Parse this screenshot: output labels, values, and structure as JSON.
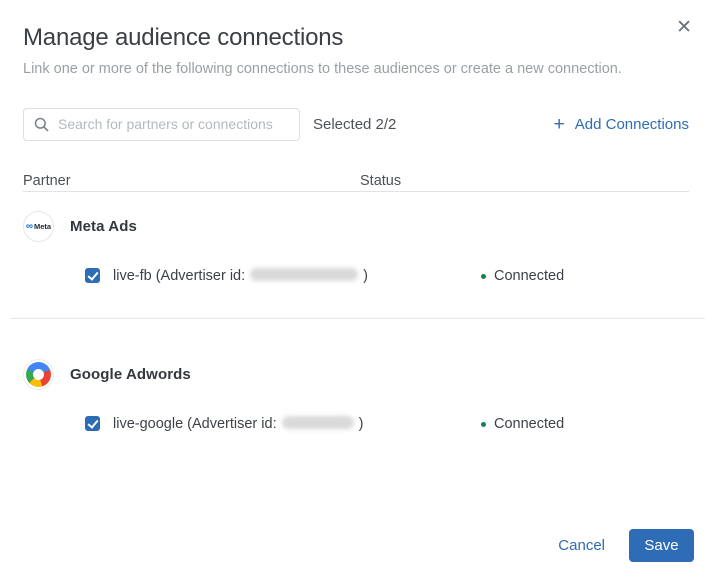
{
  "modal": {
    "title": "Manage audience connections",
    "subtitle": "Link one or more of the following connections to these audiences or create a new connection.",
    "close_icon": "✕"
  },
  "toolbar": {
    "search_placeholder": "Search for partners or connections",
    "selected_label": "Selected 2/2",
    "plus_icon": "+",
    "add_connections_label": "Add Connections"
  },
  "table": {
    "columns": [
      "Partner",
      "Status"
    ],
    "partners": [
      {
        "name": "Meta Ads",
        "logo": "meta-logo",
        "logo_glyph": "∞",
        "logo_text": "Meta",
        "connections": [
          {
            "checked": true,
            "label_prefix": "live-fb (Advertiser id:",
            "advertiser_id_redacted": true,
            "label_suffix": ")",
            "status": "Connected"
          }
        ]
      },
      {
        "name": "Google Adwords",
        "logo": "google-adwords-logo",
        "connections": [
          {
            "checked": true,
            "label_prefix": "live-google (Advertiser id:",
            "advertiser_id_redacted": true,
            "label_suffix": ")",
            "status": "Connected"
          }
        ]
      }
    ]
  },
  "footer": {
    "cancel_label": "Cancel",
    "save_label": "Save"
  },
  "colors": {
    "accent_blue": "#2e6cb5",
    "status_green": "#17804f",
    "meta_blue": "#0668e1",
    "google_blue": "#4285f4",
    "google_red": "#ea4335",
    "google_yellow": "#fbbc05",
    "google_green": "#34a853",
    "divider_gray": "#e4e6e8",
    "subtitle_gray": "#9ba0a5"
  }
}
